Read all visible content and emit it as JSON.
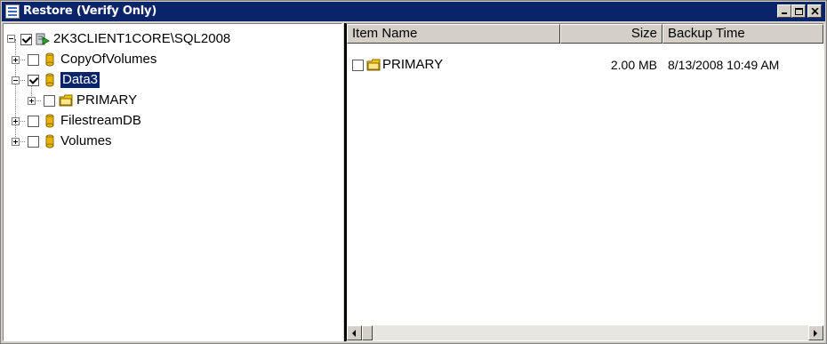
{
  "window": {
    "title": "Restore (Verify Only)",
    "controls": {
      "minimize": "minimize",
      "maximize": "maximize",
      "close": "close"
    }
  },
  "tree": {
    "root": {
      "label": "2K3CLIENT1CORE\\SQL2008",
      "checked": true,
      "expanded": true,
      "icon": "server-icon"
    },
    "items": [
      {
        "label": "CopyOfVolumes",
        "checked": false,
        "expanded": false,
        "icon": "database-icon"
      },
      {
        "label": "Data3",
        "checked": true,
        "expanded": true,
        "selected": true,
        "icon": "database-icon",
        "children": [
          {
            "label": "PRIMARY",
            "checked": false,
            "expanded": false,
            "icon": "folder-icon"
          }
        ]
      },
      {
        "label": "FilestreamDB",
        "checked": false,
        "expanded": false,
        "icon": "database-icon"
      },
      {
        "label": "Volumes",
        "checked": false,
        "expanded": false,
        "icon": "database-icon"
      }
    ]
  },
  "list": {
    "columns": [
      "Item Name",
      "Size",
      "Backup Time"
    ],
    "rows": [
      {
        "name": "PRIMARY",
        "size": "2.00 MB",
        "backup_time": "8/13/2008 10:49 AM",
        "checked": false,
        "icon": "folder-icon"
      }
    ]
  },
  "colors": {
    "titlebar": "#0a246a",
    "selection": "#0a246a",
    "window_face": "#d4d0c8",
    "database_icon": "#e8b400",
    "folder_icon": "#f5c400"
  }
}
